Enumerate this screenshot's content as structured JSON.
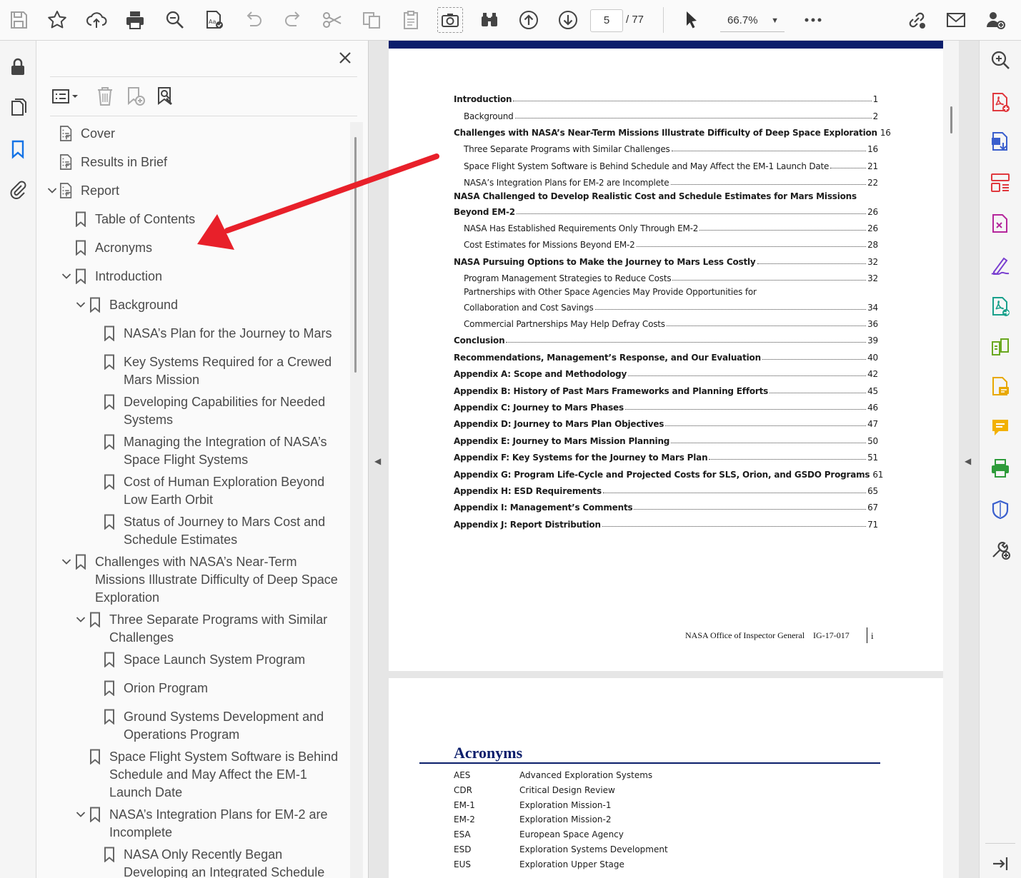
{
  "toolbar": {
    "page_current": "5",
    "page_total": "/ 77",
    "zoom": "66.7%",
    "icons": [
      "save-icon",
      "bookmark-star-icon",
      "upload-cloud-icon",
      "print-icon",
      "search-zoom-icon",
      "edit-text-icon",
      "undo-icon",
      "redo-icon",
      "cut-icon",
      "copy-icon",
      "paste-icon",
      "snapshot-icon",
      "find-binoculars-icon",
      "prev-page-icon",
      "next-page-icon",
      "select-cursor-icon",
      "more-icon",
      "share-link-icon",
      "email-icon",
      "add-user-icon"
    ]
  },
  "bookmarks": {
    "items": [
      {
        "label": "Cover"
      },
      {
        "label": "Results in Brief"
      },
      {
        "label": "Report"
      },
      {
        "label": "Table of Contents"
      },
      {
        "label": "Acronyms"
      },
      {
        "label": "Introduction"
      },
      {
        "label": "Background"
      },
      {
        "label": "NASA’s Plan for the Journey to Mars"
      },
      {
        "label": "Key Systems Required for a Crewed",
        "label2": "Mars Mission"
      },
      {
        "label": "Developing Capabilities for Needed",
        "label2": "Systems"
      },
      {
        "label": "Managing the Integration of NASA’s",
        "label2": "Space Flight Systems"
      },
      {
        "label": "Cost of Human Exploration Beyond",
        "label2": "Low Earth Orbit"
      },
      {
        "label": "Status of Journey to Mars Cost and",
        "label2": "Schedule Estimates"
      },
      {
        "label": "Challenges with NASA’s Near-Term",
        "label2": "Missions Illustrate Difficulty of Deep Space",
        "label3": "Exploration"
      },
      {
        "label": "Three Separate Programs with Similar",
        "label2": "Challenges"
      },
      {
        "label": "Space Launch System Program"
      },
      {
        "label": "Orion Program"
      },
      {
        "label": "Ground Systems Development and",
        "label2": "Operations Program"
      },
      {
        "label": "Space Flight System Software is Behind",
        "label2": "Schedule and May Affect the EM-1",
        "label3": "Launch Date"
      },
      {
        "label": "NASA’s Integration Plans for EM-2 are",
        "label2": "Incomplete"
      },
      {
        "label": "NASA Only Recently Began",
        "label2": "Developing an Integrated Schedule"
      }
    ]
  },
  "toc": {
    "rows": [
      {
        "t": "Introduction",
        "p": "1"
      },
      {
        "t": "Background",
        "p": "2"
      },
      {
        "t": "Challenges with NASA’s Near-Term Missions Illustrate Difficulty of Deep Space Exploration",
        "p": "16"
      },
      {
        "t": "Three Separate Programs with Similar Challenges",
        "p": "16"
      },
      {
        "t": "Space Flight System Software is Behind Schedule and May Affect the EM-1 Launch Date",
        "p": "21"
      },
      {
        "t": "NASA’s Integration Plans for EM-2 are Incomplete",
        "p": "22"
      },
      {
        "t1": "NASA Challenged to Develop Realistic Cost and Schedule Estimates for Mars Missions",
        "t": "Beyond EM-2",
        "p": "26"
      },
      {
        "t": "NASA Has Established Requirements Only Through EM-2",
        "p": "26"
      },
      {
        "t": "Cost Estimates for Missions Beyond EM-2",
        "p": "28"
      },
      {
        "t": "NASA Pursuing Options to Make the Journey to Mars Less Costly",
        "p": "32"
      },
      {
        "t": "Program Management Strategies to Reduce Costs",
        "p": "32"
      },
      {
        "t1": "Partnerships with Other Space Agencies May Provide Opportunities for",
        "t": "Collaboration and Cost Savings",
        "p": "34"
      },
      {
        "t": "Commercial Partnerships May Help Defray Costs",
        "p": "36"
      },
      {
        "t": "Conclusion",
        "p": "39"
      },
      {
        "t": "Recommendations, Management’s Response, and Our Evaluation",
        "p": "40"
      },
      {
        "t": "Appendix A:  Scope and Methodology",
        "p": "42"
      },
      {
        "t": "Appendix B:  History of Past Mars Frameworks and Planning Efforts",
        "p": "45"
      },
      {
        "t": "Appendix C:  Journey to Mars Phases",
        "p": "46"
      },
      {
        "t": "Appendix D:  Journey to Mars Plan Objectives",
        "p": "47"
      },
      {
        "t": "Appendix E:  Journey to Mars Mission  Planning",
        "p": "50"
      },
      {
        "t": "Appendix F:  Key Systems for the Journey to Mars Plan",
        "p": "51"
      },
      {
        "t": "Appendix G:  Program Life-Cycle and Projected Costs for SLS, Orion, and GSDO Programs",
        "p": "61"
      },
      {
        "t": "Appendix H:  ESD Requirements",
        "p": "65"
      },
      {
        "t": "Appendix I:  Management’s Comments",
        "p": "67"
      },
      {
        "t": "Appendix J:  Report Distribution",
        "p": "71"
      }
    ],
    "footer": "NASA Office of Inspector General    IG-17-017",
    "footer_page": "i"
  },
  "acronyms": {
    "title": "Acronyms",
    "rows": [
      {
        "a": "AES",
        "d": "Advanced Exploration Systems"
      },
      {
        "a": "CDR",
        "d": "Critical Design Review"
      },
      {
        "a": "EM-1",
        "d": "Exploration Mission-1"
      },
      {
        "a": "EM-2",
        "d": "Exploration Mission-2"
      },
      {
        "a": "ESA",
        "d": "European Space Agency"
      },
      {
        "a": "ESD",
        "d": "Exploration Systems Development"
      },
      {
        "a": "EUS",
        "d": "Exploration Upper Stage"
      }
    ]
  },
  "colors": {
    "accent_blue": "#1473e6",
    "doc_navy": "#0b1e6b",
    "annotation_red": "#e8202a"
  }
}
